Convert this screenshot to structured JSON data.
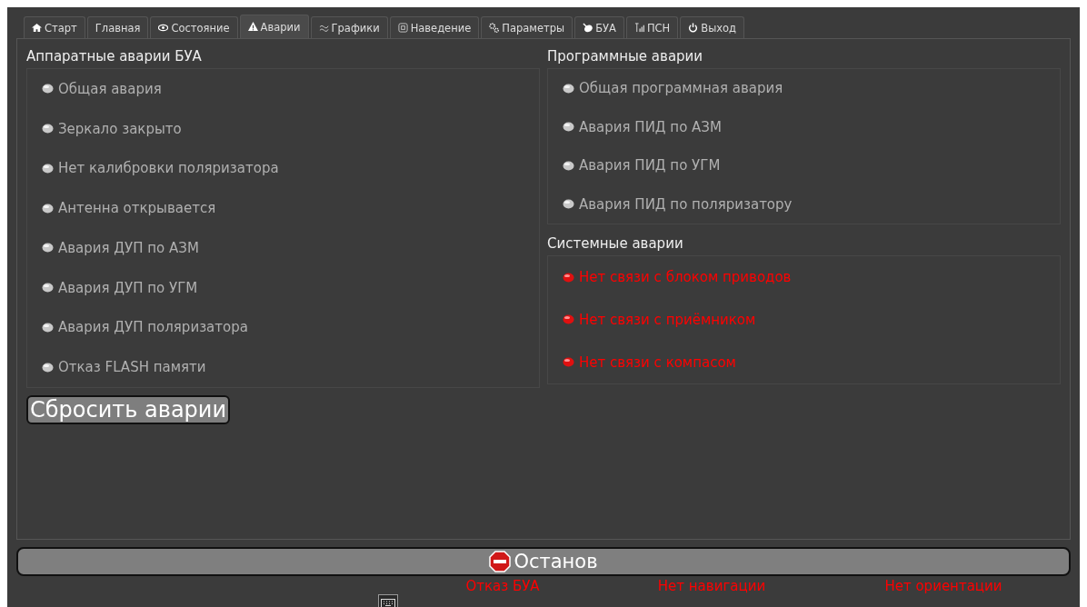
{
  "tabs": [
    {
      "label": "Старт",
      "selected": false
    },
    {
      "label": "Главная",
      "selected": false
    },
    {
      "label": "Состояние",
      "selected": false
    },
    {
      "label": "Аварии",
      "selected": true
    },
    {
      "label": "Графики",
      "selected": false
    },
    {
      "label": "Наведение",
      "selected": false
    },
    {
      "label": "Параметры",
      "selected": false
    },
    {
      "label": "БУА",
      "selected": false
    },
    {
      "label": "ПСН",
      "selected": false
    },
    {
      "label": "Выход",
      "selected": false
    }
  ],
  "hardware_alarms": {
    "title": "Аппаратные аварии БУА",
    "items": [
      {
        "label": "Общая авария",
        "active": false
      },
      {
        "label": "Зеркало закрыто",
        "active": false
      },
      {
        "label": "Нет калибровки поляризатора",
        "active": false
      },
      {
        "label": "Антенна открывается",
        "active": false
      },
      {
        "label": "Авария ДУП по АЗМ",
        "active": false
      },
      {
        "label": "Авария ДУП по УГМ",
        "active": false
      },
      {
        "label": "Авария ДУП поляризатора",
        "active": false
      },
      {
        "label": "Отказ FLASH памяти",
        "active": false
      }
    ]
  },
  "software_alarms": {
    "title": "Программные аварии",
    "items": [
      {
        "label": "Общая программная авария",
        "active": false
      },
      {
        "label": "Авария ПИД по АЗМ",
        "active": false
      },
      {
        "label": "Авария ПИД по УГМ",
        "active": false
      },
      {
        "label": "Авария ПИД по поляризатору",
        "active": false
      }
    ]
  },
  "system_alarms": {
    "title": "Системные аварии",
    "items": [
      {
        "label": "Нет связи с блоком приводов",
        "active": true
      },
      {
        "label": "Нет связи с приёмником",
        "active": true
      },
      {
        "label": "Нет связи с компасом",
        "active": true
      }
    ]
  },
  "reset_button": "Сбросить аварии",
  "stop_button": "Останов",
  "status_bar": [
    "Отказ БУА",
    "Нет навигации",
    "Нет ориентации"
  ]
}
